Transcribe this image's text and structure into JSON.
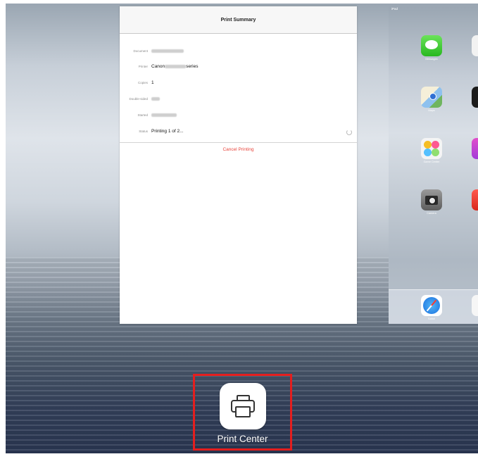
{
  "print_summary": {
    "title": "Print Summary",
    "rows": [
      {
        "label": "Document",
        "value": ""
      },
      {
        "label": "Printer",
        "value_prefix": "Canon",
        "value_suffix": "series"
      },
      {
        "label": "Copies",
        "value": "1"
      },
      {
        "label": "Double-sided",
        "value": ""
      },
      {
        "label": "Started",
        "value": ""
      },
      {
        "label": "Status",
        "value": "Printing 1 of 2..."
      }
    ],
    "cancel_label": "Cancel Printing"
  },
  "home_screen": {
    "status": "iPad",
    "apps": [
      {
        "name": "Messages",
        "icon": "messages-icon"
      },
      {
        "name": "Maps",
        "icon": "maps-icon"
      },
      {
        "name": "Game Center",
        "icon": "game-center-icon"
      },
      {
        "name": "Camera",
        "icon": "camera-icon"
      }
    ],
    "dock": [
      {
        "name": "Safari",
        "icon": "safari-icon"
      }
    ]
  },
  "print_center": {
    "label": "Print Center",
    "icon": "printer-icon",
    "highlight_color": "#e41e1e"
  },
  "colors": {
    "accent_red": "#e8453c",
    "highlight": "#e41e1e"
  }
}
